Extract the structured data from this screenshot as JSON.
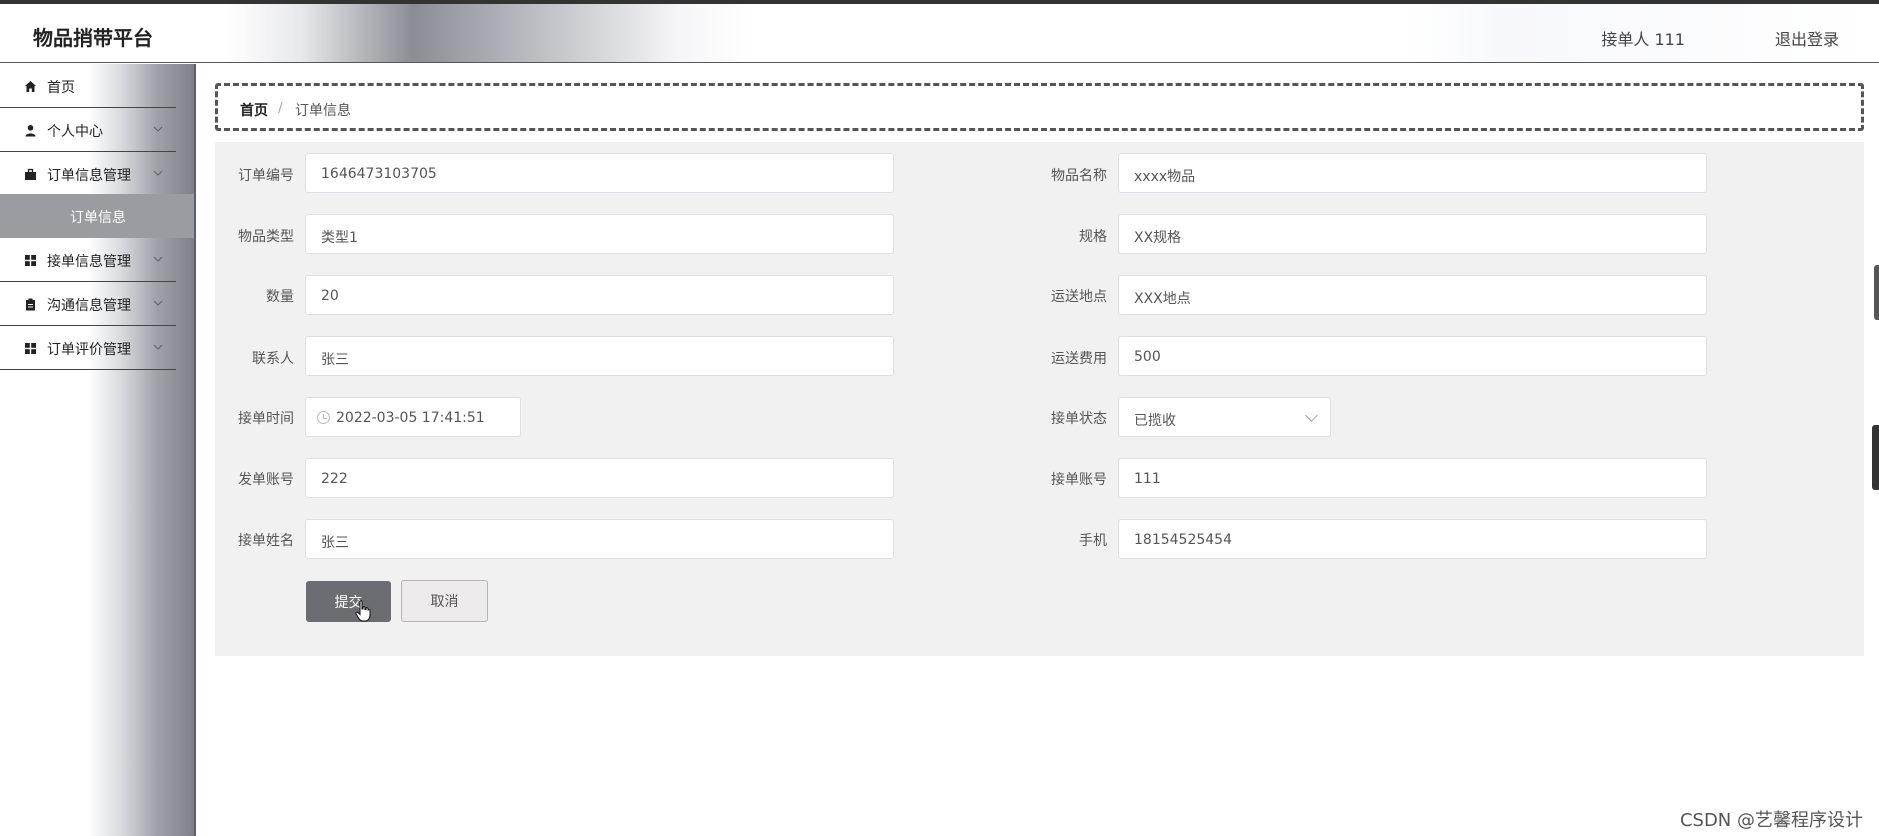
{
  "header": {
    "brand": "物品捎带平台",
    "user_label": "接单人 111",
    "logout_label": "退出登录"
  },
  "sidebar": {
    "items": [
      {
        "label": "首页",
        "icon": "home-icon"
      },
      {
        "label": "个人中心",
        "icon": "user-icon"
      },
      {
        "label": "订单信息管理",
        "icon": "briefcase-icon"
      },
      {
        "label": "接单信息管理",
        "icon": "grid-icon"
      },
      {
        "label": "沟通信息管理",
        "icon": "clipboard-icon"
      },
      {
        "label": "订单评价管理",
        "icon": "grid-icon"
      }
    ],
    "active_sub": "订单信息"
  },
  "breadcrumb": {
    "home": "首页",
    "separator": "/",
    "current": "订单信息"
  },
  "form": {
    "order_no": {
      "label": "订单编号",
      "value": "1646473103705"
    },
    "item_name": {
      "label": "物品名称",
      "value": "xxxx物品"
    },
    "item_type": {
      "label": "物品类型",
      "value": "类型1"
    },
    "spec": {
      "label": "规格",
      "value": "XX规格"
    },
    "quantity": {
      "label": "数量",
      "value": "20"
    },
    "destination": {
      "label": "运送地点",
      "value": "XXX地点"
    },
    "contact": {
      "label": "联系人",
      "value": "张三"
    },
    "fee": {
      "label": "运送费用",
      "value": "500"
    },
    "accept_time": {
      "label": "接单时间",
      "value": "2022-03-05 17:41:51"
    },
    "accept_status": {
      "label": "接单状态",
      "value": "已揽收"
    },
    "sender_account": {
      "label": "发单账号",
      "value": "222"
    },
    "receiver_account": {
      "label": "接单账号",
      "value": "111"
    },
    "receiver_name": {
      "label": "接单姓名",
      "value": "张三"
    },
    "phone": {
      "label": "手机",
      "value": "18154525454"
    },
    "submit_label": "提交",
    "cancel_label": "取消"
  },
  "watermark": "CSDN @艺馨程序设计",
  "colors": {
    "accent_button": "#6b6d72",
    "panel_bg": "#f1f1f1",
    "submenu_bg": "#9a9ca2"
  }
}
